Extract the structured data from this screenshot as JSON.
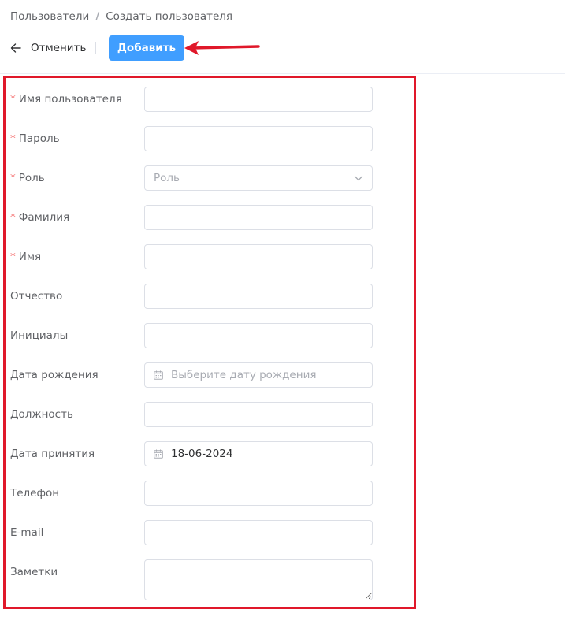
{
  "breadcrumb": {
    "parent": "Пользователи",
    "separator": "/",
    "current": "Создать пользователя"
  },
  "toolbar": {
    "cancel_label": "Отменить",
    "add_label": "Добавить"
  },
  "form": {
    "username": {
      "label": "Имя пользователя",
      "required": "*",
      "value": ""
    },
    "password": {
      "label": "Пароль",
      "required": "*",
      "value": ""
    },
    "role": {
      "label": "Роль",
      "required": "*",
      "placeholder": "Роль"
    },
    "last_name": {
      "label": "Фамилия",
      "required": "*",
      "value": ""
    },
    "first_name": {
      "label": "Имя",
      "required": "*",
      "value": ""
    },
    "patronymic": {
      "label": "Отчество",
      "value": ""
    },
    "initials": {
      "label": "Инициалы",
      "value": ""
    },
    "birth_date": {
      "label": "Дата рождения",
      "placeholder": "Выберите дату рождения"
    },
    "position": {
      "label": "Должность",
      "value": ""
    },
    "hire_date": {
      "label": "Дата принятия",
      "value": "18-06-2024"
    },
    "phone": {
      "label": "Телефон",
      "value": ""
    },
    "email": {
      "label": "E-mail",
      "value": ""
    },
    "notes": {
      "label": "Заметки",
      "value": ""
    }
  },
  "colors": {
    "primary": "#409eff",
    "required": "#f56c6c",
    "annotation": "#e0182a"
  },
  "icons": {
    "back": "arrow-left-icon",
    "select": "chevron-down-icon",
    "date": "calendar-icon"
  }
}
